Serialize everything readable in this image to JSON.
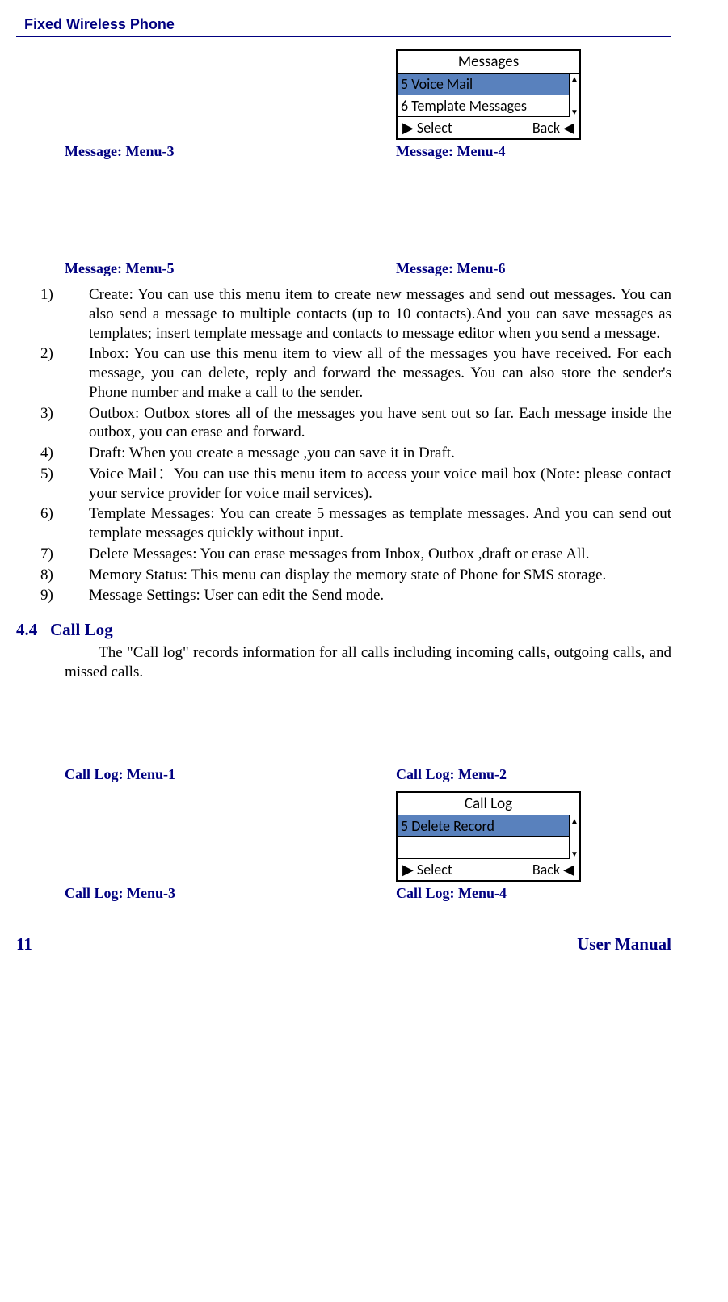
{
  "header": {
    "title": "Fixed Wireless Phone"
  },
  "screen1": {
    "title": "Messages",
    "row1": "5 Voice Mail",
    "row2": "6 Template Messages",
    "sk_left": "Select",
    "sk_right": "Back"
  },
  "captions": {
    "msg3": "Message: Menu-3",
    "msg4": "Message: Menu-4",
    "msg5": "Message: Menu-5",
    "msg6": "Message: Menu-6",
    "cl1": "Call Log: Menu-1",
    "cl2": "Call Log: Menu-2",
    "cl3": "Call Log: Menu-3",
    "cl4": "Call Log: Menu-4"
  },
  "list": {
    "i1n": "1)",
    "i1": "Create: You can use this menu item to create new messages and send out messages. You can also send a message to multiple contacts (up to 10 contacts).And you can save messages as templates; insert  template message and contacts to message editor when you send a message.",
    "i2n": "2)",
    "i2": "Inbox: You can use this menu item to view all of the messages you have received. For each message, you can delete, reply and forward the messages. You can also store the sender's Phone number and make a call to the sender.",
    "i3n": "3)",
    "i3": "Outbox: Outbox stores all of the messages you have sent out so far. Each message inside the outbox, you can erase and forward.",
    "i4n": "4)",
    "i4": "Draft: When you create a message ,you can save it in Draft.",
    "i5n": "5)",
    "i5": "Voice Mail：You can use this menu item to access your voice mail box (Note: please contact your service provider for voice mail services).",
    "i6n": "6)",
    "i6": "Template Messages: You can create 5 messages as template messages. And you can send out  template messages quickly without input.",
    "i7n": "7)",
    "i7": "Delete Messages: You can erase messages from Inbox, Outbox ,draft or erase All.",
    "i8n": "8)",
    "i8": "Memory Status: This menu can display the memory state of Phone for SMS storage.",
    "i9n": "9)",
    "i9": "Message Settings: User can edit the Send mode."
  },
  "section": {
    "num": "4.4",
    "title": "Call Log",
    "para": "The \"Call log\" records information for all calls including incoming calls, outgoing calls, and missed calls."
  },
  "screen2": {
    "title": "Call Log",
    "row1": "5 Delete Record",
    "sk_left": "Select",
    "sk_right": "Back"
  },
  "footer": {
    "page": "11",
    "label": "User Manual"
  }
}
